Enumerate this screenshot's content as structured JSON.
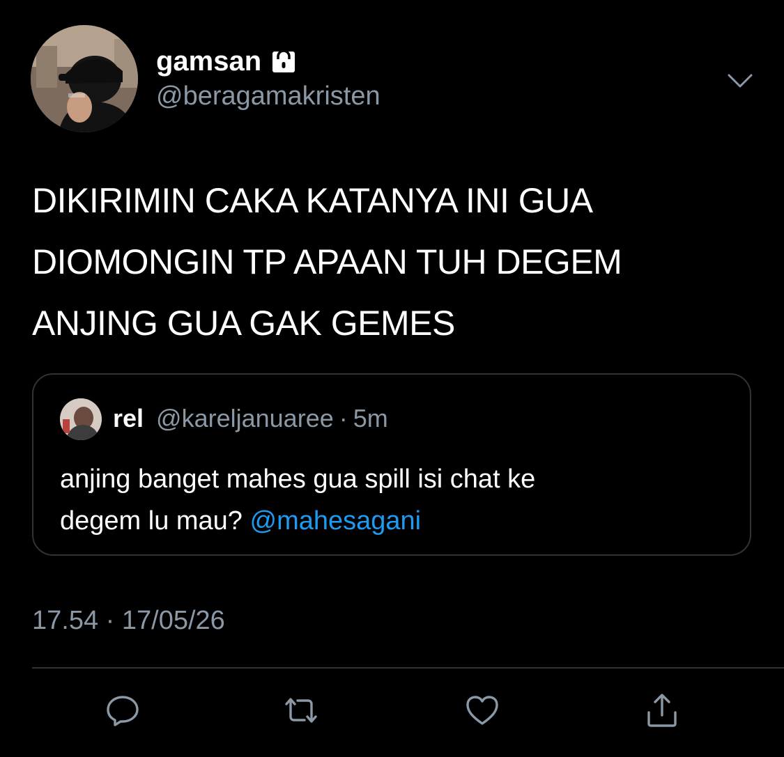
{
  "author": {
    "display_name": "gamsan",
    "handle": "@beragamakristen",
    "protected_icon": "lock-icon",
    "avatar_icon": "avatar-photo"
  },
  "tweet": {
    "text_lines": [
      "DIKIRIMIN CAKA KATANYA INI GUA",
      "DIOMONGIN TP APAAN TUH DEGEM",
      "ANJING GUA GAK GEMES"
    ]
  },
  "quote": {
    "name": "rel",
    "handle": "@kareljanuaree",
    "separator": "·",
    "time": "5m",
    "text_line1": "anjing banget mahes gua spill isi chat ke",
    "text_line2_prefix": "degem lu mau? ",
    "mention": "@mahesagani"
  },
  "timestamp": "17.54 · 17/05/26",
  "menu_icon": "chevron-down-icon",
  "actions": [
    {
      "name": "reply",
      "icon": "reply-icon"
    },
    {
      "name": "retweet",
      "icon": "retweet-icon"
    },
    {
      "name": "like",
      "icon": "heart-icon"
    },
    {
      "name": "share",
      "icon": "share-icon"
    }
  ],
  "colors": {
    "background": "#000000",
    "text": "#ffffff",
    "secondary": "#8b98a5",
    "accent": "#1d9bf0",
    "border": "#2f3336"
  }
}
